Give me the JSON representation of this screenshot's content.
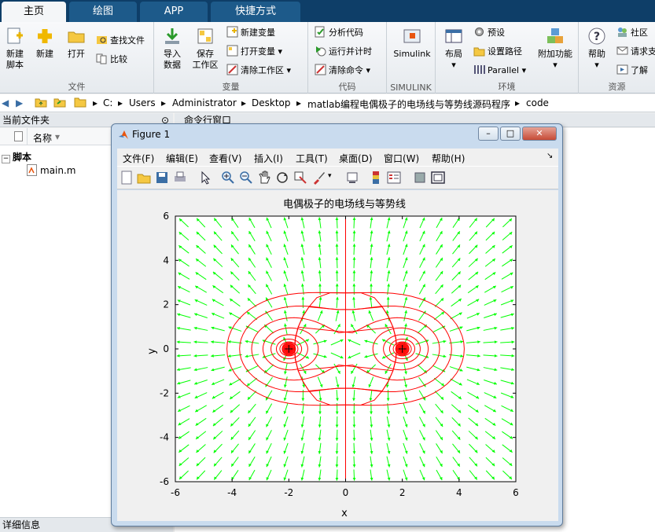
{
  "tabs": {
    "home": "主页",
    "plots": "绘图",
    "apps": "APP",
    "shortcuts": "快捷方式"
  },
  "ribbon": {
    "file": {
      "new_script": "新建\n脚本",
      "new": "新建",
      "open": "打开",
      "find_files": "查找文件",
      "compare": "比较",
      "label": "文件"
    },
    "variable": {
      "import_data": "导入\n数据",
      "save_workspace": "保存\n工作区",
      "new_variable": "新建变量",
      "open_variable": "打开变量",
      "clear_workspace": "清除工作区",
      "label": "变量"
    },
    "code": {
      "analyze_code": "分析代码",
      "run_and_time": "运行并计时",
      "clear_commands": "清除命令",
      "label": "代码"
    },
    "simulink": {
      "simulink": "Simulink",
      "label": "SIMULINK"
    },
    "environment": {
      "layout": "布局",
      "preferences": "预设",
      "set_path": "设置路径",
      "parallel": "Parallel",
      "addons": "附加功能",
      "label": "环境"
    },
    "resources": {
      "help": "帮助",
      "community": "社区",
      "request_support": "请求支",
      "learn": "了解",
      "label": "资源"
    }
  },
  "address": {
    "parts": [
      "C:",
      "Users",
      "Administrator",
      "Desktop",
      "matlab编程电偶极子的电场线与等势线源码程序",
      "code"
    ]
  },
  "current_folder": {
    "title": "当前文件夹",
    "name_header": "名称",
    "group": "脚本",
    "file": "main.m"
  },
  "command_window": {
    "title": "命令行窗口"
  },
  "details": "详细信息",
  "figure": {
    "title": "Figure 1",
    "menu": [
      "文件(F)",
      "编辑(E)",
      "查看(V)",
      "插入(I)",
      "工具(T)",
      "桌面(D)",
      "窗口(W)",
      "帮助(H)"
    ]
  },
  "colors": {
    "field_lines": "#00ff00",
    "equipotentials": "#ff0000",
    "axes": "#000000"
  },
  "chart_data": {
    "type": "vector_field_contour",
    "title": "电偶极子的电场线与等势线",
    "xlabel": "x",
    "ylabel": "y",
    "xlim": [
      -6,
      6
    ],
    "ylim": [
      -6,
      6
    ],
    "xticks": [
      "-6",
      "-4",
      "-2",
      "0",
      "2",
      "4",
      "6"
    ],
    "yticks": [
      "-6",
      "-4",
      "-2",
      "0",
      "2",
      "4",
      "6"
    ],
    "charges": [
      {
        "x": -2,
        "y": 0
      },
      {
        "x": 2,
        "y": 0
      }
    ],
    "vector_field": {
      "grid_spacing": 0.6,
      "color": "#00ff00"
    },
    "contours": {
      "color": "#ff0000"
    },
    "grid": false
  }
}
